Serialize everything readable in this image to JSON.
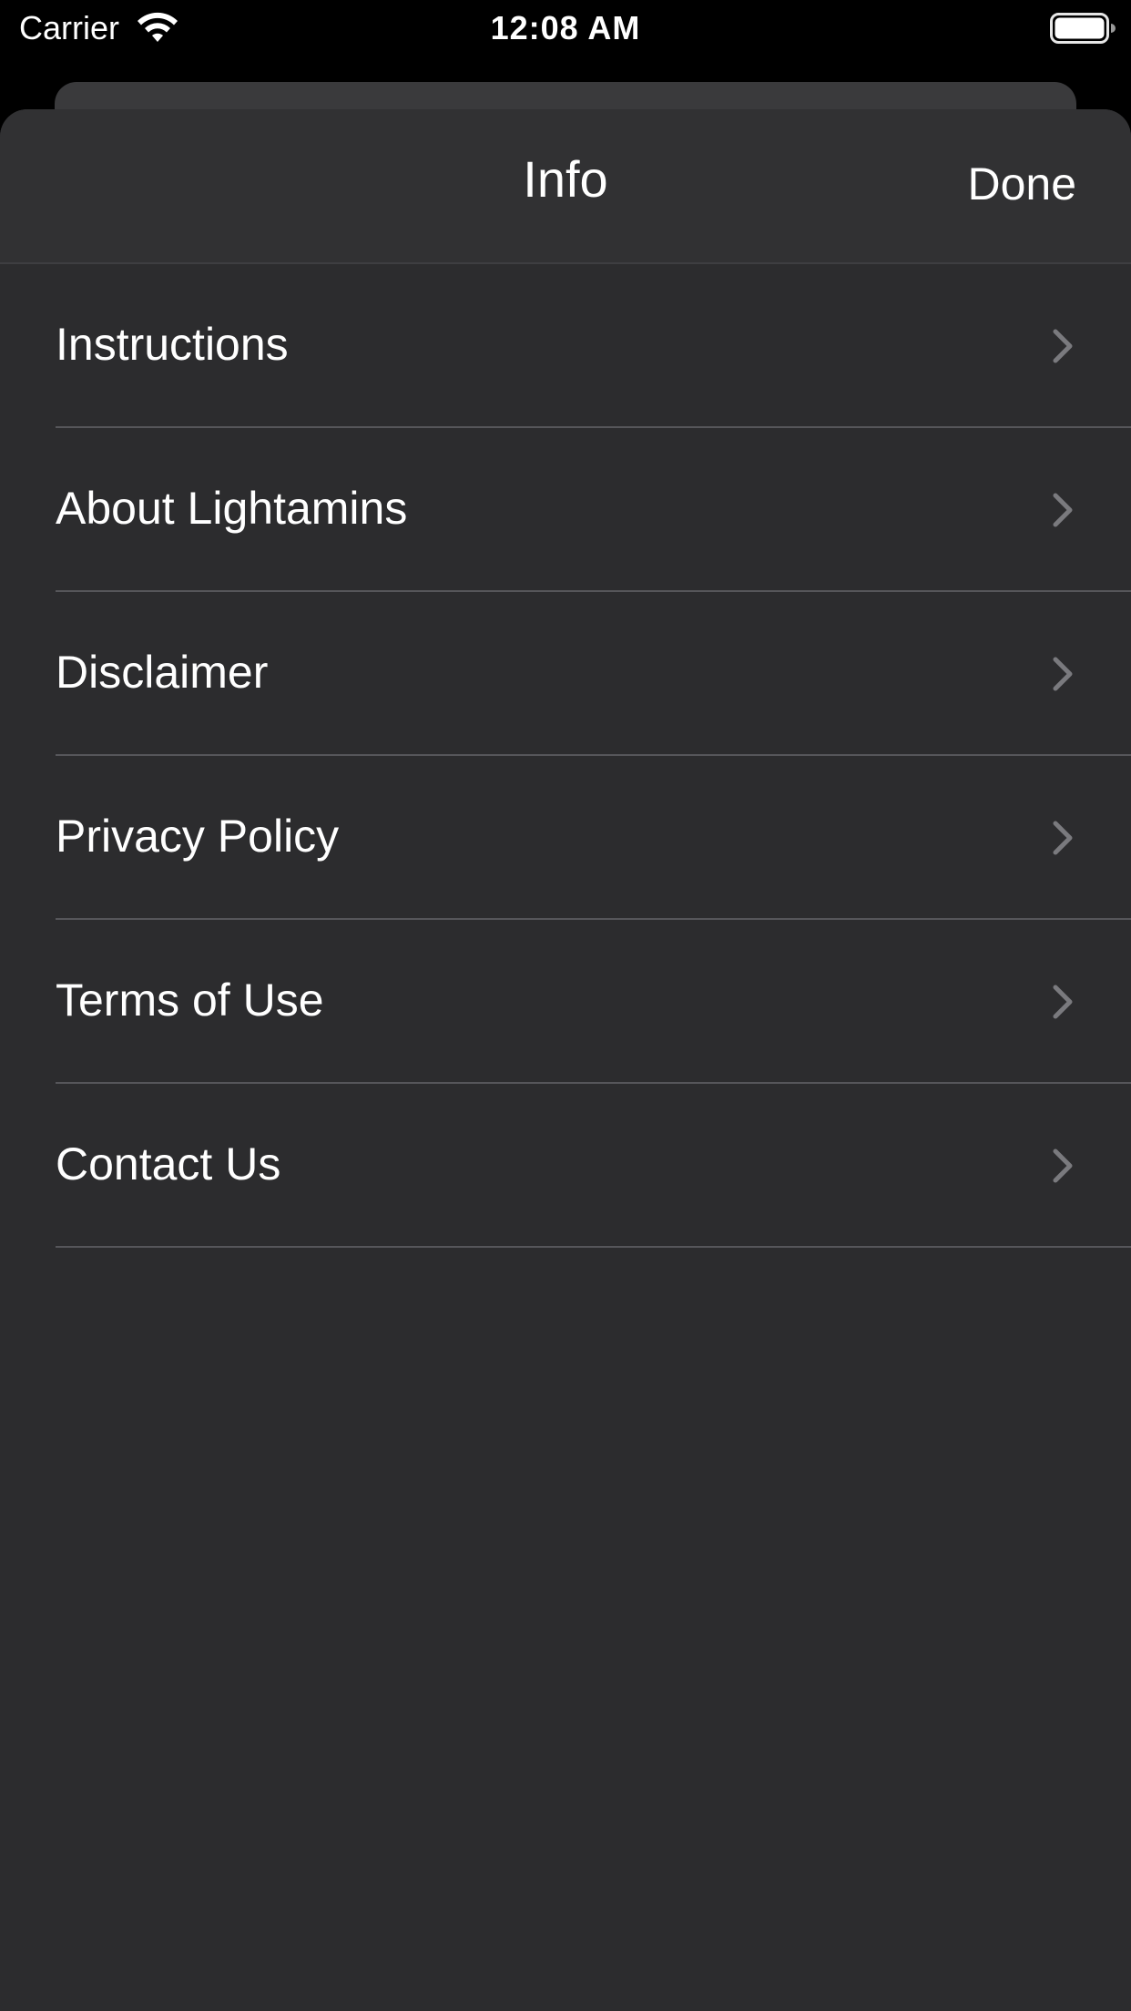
{
  "status_bar": {
    "carrier": "Carrier",
    "time": "12:08 AM",
    "wifi_icon": "wifi-icon",
    "battery_icon": "battery-full-icon"
  },
  "nav": {
    "title": "Info",
    "done_label": "Done"
  },
  "menu": {
    "items": [
      {
        "label": "Instructions",
        "icon": "chevron-right-icon"
      },
      {
        "label": "About Lightamins",
        "icon": "chevron-right-icon"
      },
      {
        "label": "Disclaimer",
        "icon": "chevron-right-icon"
      },
      {
        "label": "Privacy Policy",
        "icon": "chevron-right-icon"
      },
      {
        "label": "Terms of Use",
        "icon": "chevron-right-icon"
      },
      {
        "label": "Contact Us",
        "icon": "chevron-right-icon"
      }
    ]
  },
  "colors": {
    "background": "#000000",
    "sheet": "#2c2c2e",
    "nav_bar": "#313133",
    "text": "#ffffff",
    "chevron": "#7a7a7e",
    "separator": "#56565a"
  }
}
